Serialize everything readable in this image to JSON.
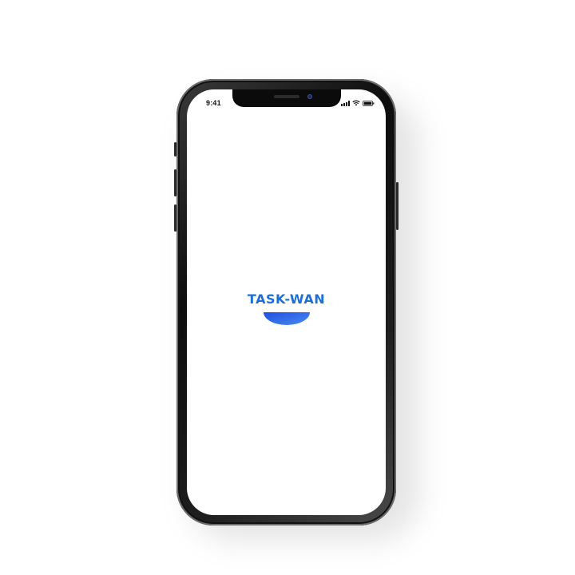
{
  "status_bar": {
    "time": "9:41",
    "icons": [
      "cellular-signal-icon",
      "wifi-icon",
      "battery-icon"
    ]
  },
  "splash": {
    "logo_text": "TASK-WAN",
    "logo_mark": "half-circle-bowl-icon"
  },
  "colors": {
    "brand_blue": "#1d6fd6",
    "bowl_gradient_start": "#1f4fe0",
    "bowl_gradient_end": "#4a8cf0",
    "screen_background": "#ffffff",
    "device_frame": "#111111"
  }
}
